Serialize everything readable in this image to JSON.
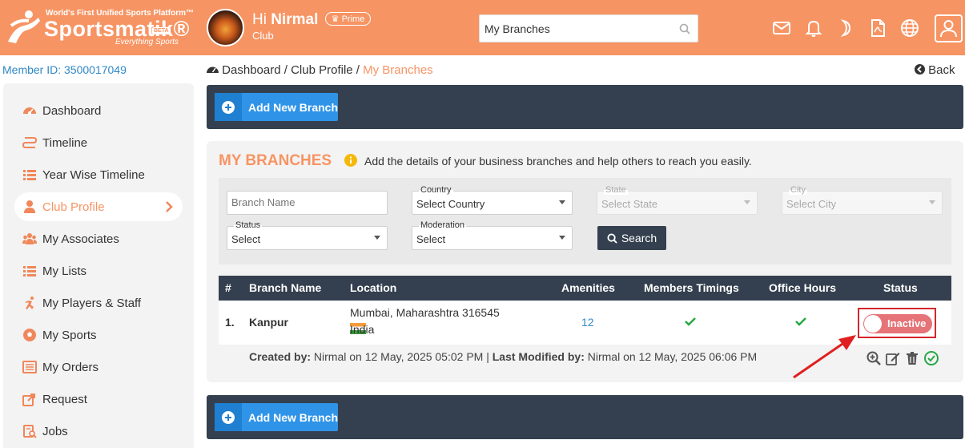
{
  "header": {
    "tagline": "World's First Unified Sports Platform™",
    "brand": "Sportsmatik®",
    "beta": "BETA",
    "motto": "Everything Sports",
    "greeting_hi": "Hi",
    "user_name": "Nirmal",
    "prime_label": "Prime",
    "role": "Club",
    "search_value": "My Branches",
    "icons": [
      "mail-icon",
      "bell-icon",
      "moon-icon",
      "pdf-file-icon",
      "globe-icon",
      "user-icon"
    ]
  },
  "sidebar": {
    "member_id": "Member ID: 3500017049",
    "items": [
      {
        "label": "Dashboard",
        "icon": "dashboard-icon"
      },
      {
        "label": "Timeline",
        "icon": "timeline-icon"
      },
      {
        "label": "Year Wise Timeline",
        "icon": "list-icon"
      },
      {
        "label": "Club Profile",
        "icon": "user-icon",
        "active": true
      },
      {
        "label": "My Associates",
        "icon": "associates-icon"
      },
      {
        "label": "My Lists",
        "icon": "list-icon"
      },
      {
        "label": "My Players & Staff",
        "icon": "runner-icon"
      },
      {
        "label": "My Sports",
        "icon": "ball-icon"
      },
      {
        "label": "My Orders",
        "icon": "orders-icon"
      },
      {
        "label": "Request",
        "icon": "request-icon"
      },
      {
        "label": "Jobs",
        "icon": "jobs-icon"
      }
    ]
  },
  "breadcrumb": {
    "dashboard": "Dashboard",
    "sep": "/",
    "club_profile": "Club Profile",
    "current": "My Branches"
  },
  "back_label": "Back",
  "add_branch_label": "Add New Branch",
  "panel": {
    "title": "MY BRANCHES",
    "description": "Add the details of your business branches and help others to reach you easily."
  },
  "filters": {
    "branch_name_placeholder": "Branch Name",
    "country_label": "Country",
    "country_value": "Select Country",
    "state_label": "State",
    "state_value": "Select State",
    "city_label": "City",
    "city_value": "Select City",
    "status_label": "Status",
    "status_value": "Select",
    "moderation_label": "Moderation",
    "moderation_value": "Select",
    "search_label": "Search"
  },
  "table": {
    "headers": [
      "#",
      "Branch Name",
      "Location",
      "Amenities",
      "Members Timings",
      "Office Hours",
      "Status"
    ],
    "rows": [
      {
        "num": "1.",
        "branch_name": "Kanpur",
        "location_line1": "Mumbai, Maharashtra 316545",
        "location_country": "India",
        "amenities": "12",
        "status": "Inactive",
        "created_by_label": "Created by:",
        "created_by_value": "Nirmal on 12 May, 2025 05:02 PM |",
        "modified_by_label": "Last Modified by:",
        "modified_by_value": "Nirmal on 12 May, 2025 06:06 PM"
      }
    ]
  },
  "colors": {
    "header_bg": "#f79463",
    "accent": "#f79463",
    "dark_bar": "#34404f",
    "button_blue": "#2f94e8",
    "inactive_toggle": "#e57377",
    "check_green": "#27a845",
    "highlight_red": "#d6262c"
  }
}
